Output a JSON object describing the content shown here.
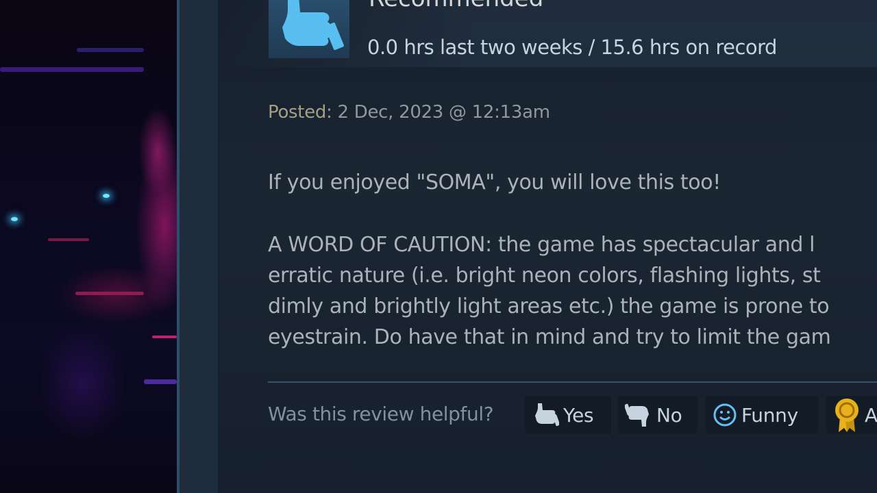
{
  "review": {
    "verdict": "Recommended",
    "hours": "0.0 hrs last two weeks / 15.6 hrs on record",
    "posted_label": "Posted:",
    "posted_date": "2 Dec, 2023 @ 12:13am",
    "body_line_1": "If you enjoyed \"SOMA\", you will love this too!",
    "body_lines_2": [
      "A WORD OF CAUTION: the game has spectacular and l",
      "erratic nature (i.e. bright neon colors, flashing lights, st",
      "dimly and brightly light areas etc.) the game is prone to",
      "eyestrain. Do have that in mind and try to limit the gam"
    ]
  },
  "helpful": {
    "question": "Was this review helpful?",
    "yes_label": "Yes",
    "no_label": "No",
    "funny_label": "Funny",
    "award_label": "A"
  },
  "icons": {
    "verdict": "thumbs-up-icon",
    "yes": "thumbs-up-icon",
    "no": "thumbs-down-icon",
    "funny": "smiley-icon",
    "award": "award-icon"
  },
  "colors": {
    "accent_blue": "#66c0f4",
    "award_gold": "#e8b21c",
    "panel_bg": "#1b2633"
  }
}
